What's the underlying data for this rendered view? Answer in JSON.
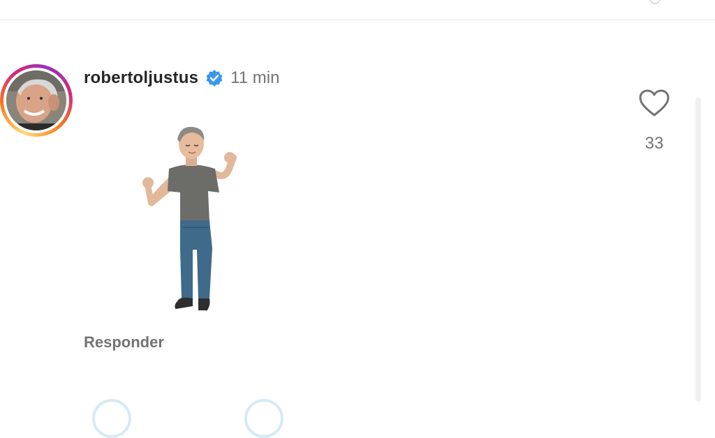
{
  "comment": {
    "username": "robertoljustus",
    "verified_icon": "verified-badge-icon",
    "time": "11 min",
    "sticker_icon": "avatar-sticker-dancing",
    "reply_label": "Responder",
    "like_icon": "heart-outline-icon",
    "like_count": "33"
  },
  "colors": {
    "verified": "#3897f0",
    "secondary_text": "#737373",
    "primary_text": "#262626"
  }
}
